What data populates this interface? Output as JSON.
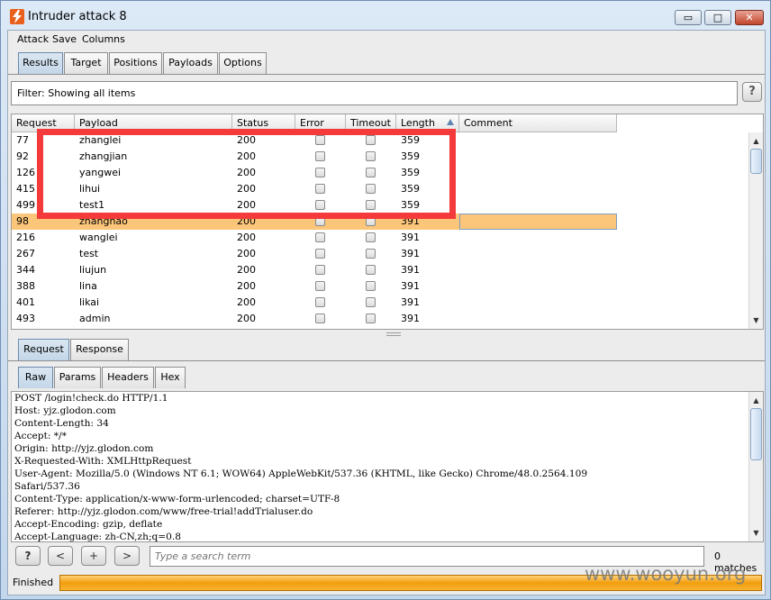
{
  "window": {
    "title": "Intruder attack 8",
    "minimize_label": "▭",
    "maximize_label": "□",
    "close_label": "✕"
  },
  "menu": [
    "Attack",
    "Save",
    "Columns"
  ],
  "main_tabs": [
    {
      "label": "Results",
      "active": true
    },
    {
      "label": "Target",
      "active": false
    },
    {
      "label": "Positions",
      "active": false
    },
    {
      "label": "Payloads",
      "active": false
    },
    {
      "label": "Options",
      "active": false
    }
  ],
  "filter": {
    "text": "Filter:  Showing all items",
    "help_label": "?"
  },
  "table": {
    "columns": [
      "Request",
      "Payload",
      "Status",
      "Error",
      "Timeout",
      "Length",
      "Comment"
    ],
    "sorted_column": "Length",
    "rows": [
      {
        "request": "77",
        "payload": "zhanglei",
        "status": "200",
        "length": "359",
        "selected": false
      },
      {
        "request": "92",
        "payload": "zhangjian",
        "status": "200",
        "length": "359",
        "selected": false
      },
      {
        "request": "126",
        "payload": "yangwei",
        "status": "200",
        "length": "359",
        "selected": false
      },
      {
        "request": "415",
        "payload": "lihui",
        "status": "200",
        "length": "359",
        "selected": false
      },
      {
        "request": "499",
        "payload": "test1",
        "status": "200",
        "length": "359",
        "selected": false
      },
      {
        "request": "98",
        "payload": "zhanghao",
        "status": "200",
        "length": "391",
        "selected": true
      },
      {
        "request": "216",
        "payload": "wanglei",
        "status": "200",
        "length": "391",
        "selected": false
      },
      {
        "request": "267",
        "payload": "test",
        "status": "200",
        "length": "391",
        "selected": false
      },
      {
        "request": "344",
        "payload": "liujun",
        "status": "200",
        "length": "391",
        "selected": false
      },
      {
        "request": "388",
        "payload": "lina",
        "status": "200",
        "length": "391",
        "selected": false
      },
      {
        "request": "401",
        "payload": "likai",
        "status": "200",
        "length": "391",
        "selected": false
      },
      {
        "request": "493",
        "payload": "admin",
        "status": "200",
        "length": "391",
        "selected": false
      }
    ]
  },
  "req_tabs": [
    {
      "label": "Request",
      "active": true
    },
    {
      "label": "Response",
      "active": false
    }
  ],
  "view_tabs": [
    {
      "label": "Raw",
      "active": true
    },
    {
      "label": "Params",
      "active": false
    },
    {
      "label": "Headers",
      "active": false
    },
    {
      "label": "Hex",
      "active": false
    }
  ],
  "request_lines": [
    "POST /login!check.do HTTP/1.1",
    "Host: yjz.glodon.com",
    "Content-Length: 34",
    "Accept: */*",
    "Origin: http://yjz.glodon.com",
    "X-Requested-With: XMLHttpRequest",
    "User-Agent: Mozilla/5.0 (Windows NT 6.1; WOW64) AppleWebKit/537.36 (KHTML, like Gecko) Chrome/48.0.2564.109",
    "Safari/537.36",
    "Content-Type: application/x-www-form-urlencoded; charset=UTF-8",
    "Referer: http://yjz.glodon.com/www/free-trial!addTrialuser.do",
    "Accept-Encoding: gzip, deflate",
    "Accept-Language: zh-CN,zh;q=0.8"
  ],
  "search": {
    "help_label": "?",
    "prev_label": "<",
    "add_label": "+",
    "next_label": ">",
    "placeholder": "Type a search term",
    "matches": "0 matches"
  },
  "status": {
    "text": "Finished",
    "progress": 1.0
  },
  "watermark": "www.wooyun.org",
  "colors": {
    "selected_row": "#fcc67a",
    "highlight_box": "#f43a3a",
    "progress": "#f29e0d"
  }
}
